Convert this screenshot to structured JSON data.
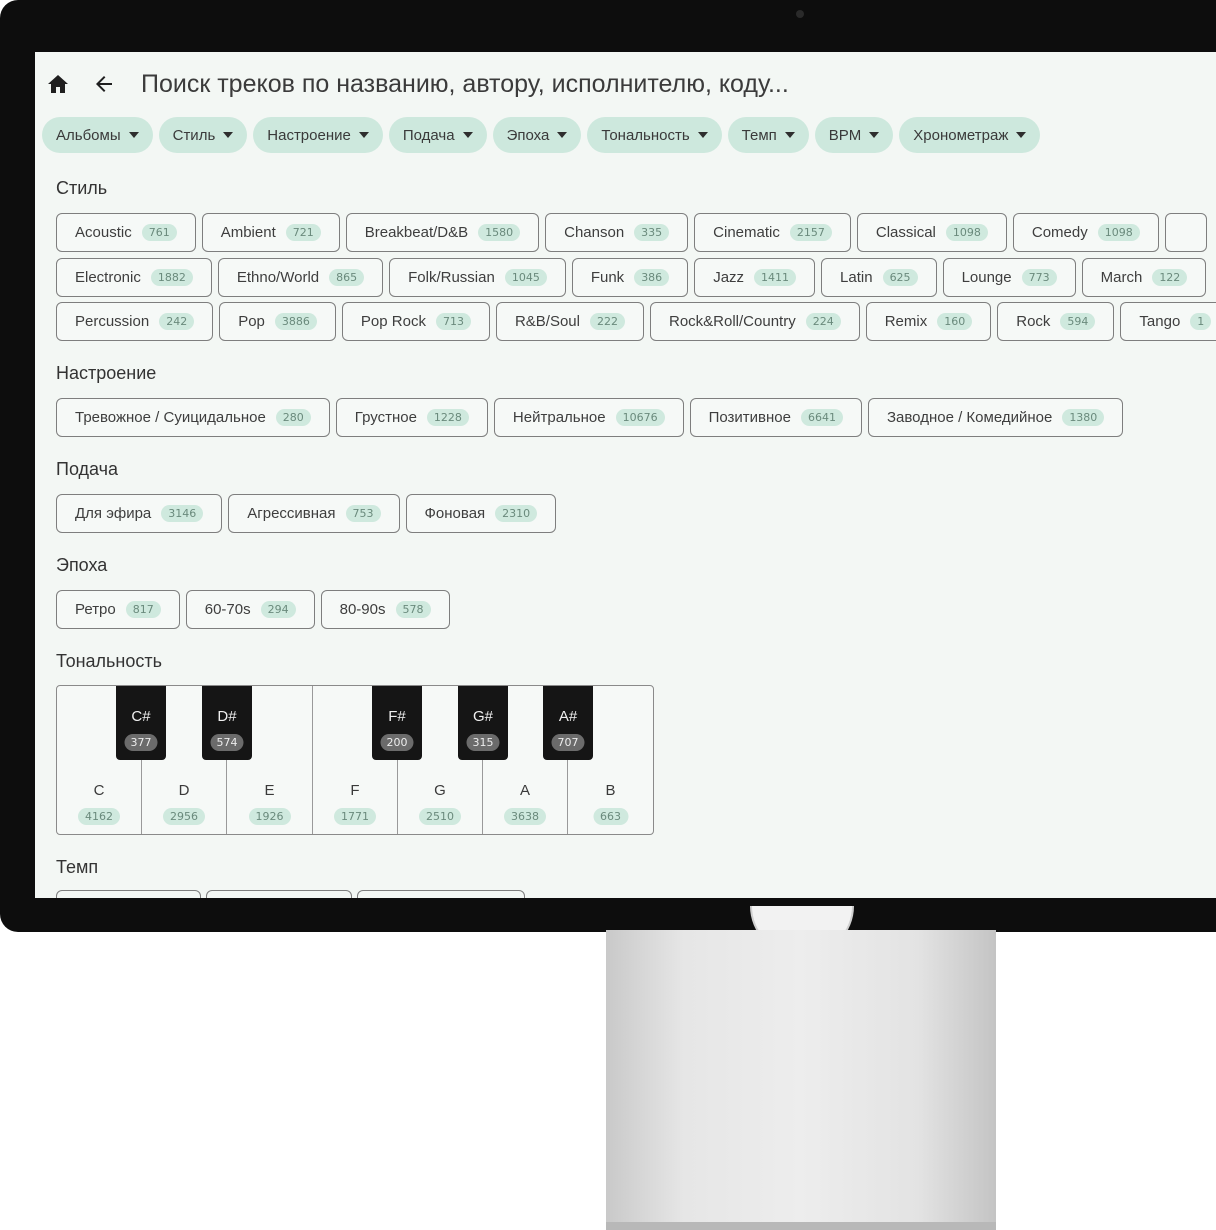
{
  "search": {
    "placeholder": "Поиск треков по названию, автору, исполнителю, коду..."
  },
  "colors": {
    "accent_chip": "#cde8dd",
    "count_badge": "#cfe9de",
    "screen_bg": "#f3f7f4",
    "black_key": "#151515"
  },
  "icons": {
    "home": "home-icon",
    "back": "arrow-left-icon",
    "dropdown": "caret-down-icon"
  },
  "filters": [
    {
      "label": "Альбомы"
    },
    {
      "label": "Стиль"
    },
    {
      "label": "Настроение"
    },
    {
      "label": "Подача"
    },
    {
      "label": "Эпоха"
    },
    {
      "label": "Тональность"
    },
    {
      "label": "Темп"
    },
    {
      "label": "BPM"
    },
    {
      "label": "Хронометраж"
    }
  ],
  "sections": {
    "style": {
      "title": "Стиль",
      "rows": [
        [
          {
            "label": "Acoustic",
            "count": "761"
          },
          {
            "label": "Ambient",
            "count": "721"
          },
          {
            "label": "Breakbeat/D&B",
            "count": "1580"
          },
          {
            "label": "Chanson",
            "count": "335"
          },
          {
            "label": "Cinematic",
            "count": "2157"
          },
          {
            "label": "Classical",
            "count": "1098"
          },
          {
            "label": "Comedy",
            "count": "1098"
          }
        ],
        [
          {
            "label": "Electronic",
            "count": "1882"
          },
          {
            "label": "Ethno/World",
            "count": "865"
          },
          {
            "label": "Folk/Russian",
            "count": "1045"
          },
          {
            "label": "Funk",
            "count": "386"
          },
          {
            "label": "Jazz",
            "count": "1411"
          },
          {
            "label": "Latin",
            "count": "625"
          },
          {
            "label": "Lounge",
            "count": "773"
          },
          {
            "label": "March",
            "count": "122"
          }
        ],
        [
          {
            "label": "Percussion",
            "count": "242"
          },
          {
            "label": "Pop",
            "count": "3886"
          },
          {
            "label": "Pop Rock",
            "count": "713"
          },
          {
            "label": "R&B/Soul",
            "count": "222"
          },
          {
            "label": "Rock&Roll/Country",
            "count": "224"
          },
          {
            "label": "Remix",
            "count": "160"
          },
          {
            "label": "Rock",
            "count": "594"
          },
          {
            "label": "Tango",
            "count": "1"
          }
        ]
      ]
    },
    "mood": {
      "title": "Настроение",
      "items": [
        {
          "label": "Тревожное / Суицидальное",
          "count": "280"
        },
        {
          "label": "Грустное",
          "count": "1228"
        },
        {
          "label": "Нейтральное",
          "count": "10676"
        },
        {
          "label": "Позитивное",
          "count": "6641"
        },
        {
          "label": "Заводное / Комедийное",
          "count": "1380"
        }
      ]
    },
    "delivery": {
      "title": "Подача",
      "items": [
        {
          "label": "Для эфира",
          "count": "3146"
        },
        {
          "label": "Агрессивная",
          "count": "753"
        },
        {
          "label": "Фоновая",
          "count": "2310"
        }
      ]
    },
    "era": {
      "title": "Эпоха",
      "items": [
        {
          "label": "Ретро",
          "count": "817"
        },
        {
          "label": "60-70s",
          "count": "294"
        },
        {
          "label": "80-90s",
          "count": "578"
        }
      ]
    },
    "key": {
      "title": "Тональность",
      "white": [
        {
          "label": "C",
          "count": "4162"
        },
        {
          "label": "D",
          "count": "2956"
        },
        {
          "label": "E",
          "count": "1926"
        },
        {
          "label": "F",
          "count": "1771"
        },
        {
          "label": "G",
          "count": "2510"
        },
        {
          "label": "A",
          "count": "3638"
        },
        {
          "label": "B",
          "count": "663"
        }
      ],
      "black": [
        {
          "label": "C#",
          "count": "377"
        },
        {
          "label": "D#",
          "count": "574"
        },
        {
          "label": "F#",
          "count": "200"
        },
        {
          "label": "G#",
          "count": "315"
        },
        {
          "label": "A#",
          "count": "707"
        }
      ]
    },
    "tempo": {
      "title": "Темп"
    }
  }
}
